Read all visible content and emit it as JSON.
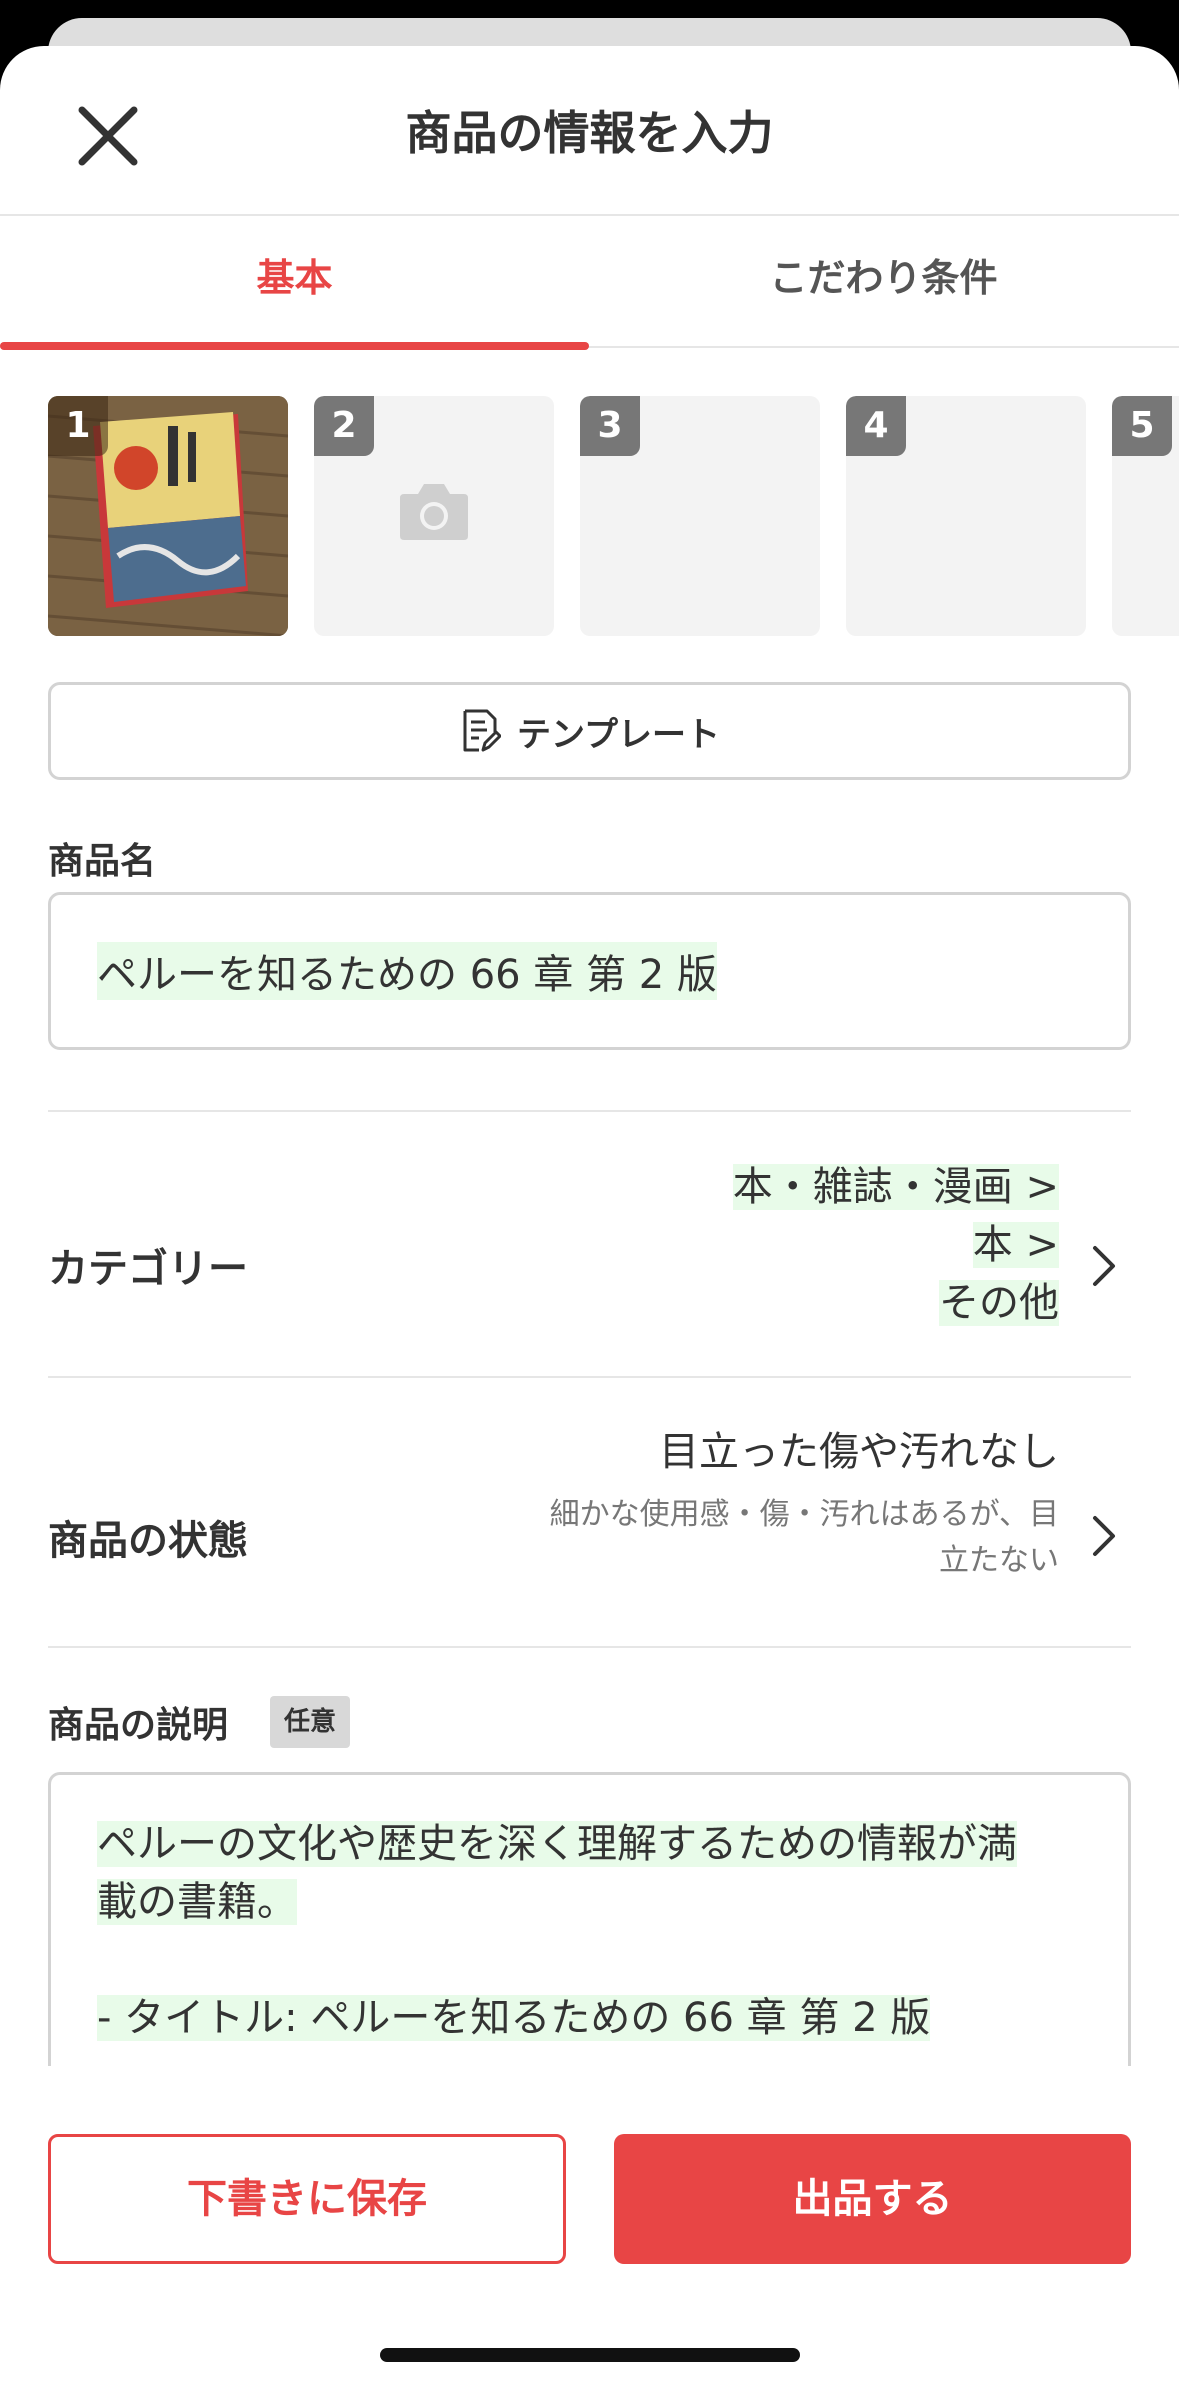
{
  "header": {
    "title": "商品の情報を入力"
  },
  "tabs": [
    {
      "label": "基本",
      "active": true
    },
    {
      "label": "こだわり条件",
      "active": false
    }
  ],
  "photos": [
    {
      "num": "1",
      "filled": true
    },
    {
      "num": "2",
      "filled": false,
      "icon": "camera-icon"
    },
    {
      "num": "3",
      "filled": false
    },
    {
      "num": "4",
      "filled": false
    },
    {
      "num": "5",
      "filled": false
    }
  ],
  "template": {
    "label": "テンプレート"
  },
  "product_name": {
    "label": "商品名",
    "value": "ペルーを知るための 66 章 第 2 版"
  },
  "category": {
    "label": "カテゴリー",
    "lines": [
      "本・雑誌・漫画 >",
      "本 >",
      "その他"
    ]
  },
  "condition": {
    "label": "商品の状態",
    "value": "目立った傷や汚れなし",
    "sub_line1": "細かな使用感・傷・汚れはあるが、目",
    "sub_line2": "立たない"
  },
  "description": {
    "label": "商品の説明",
    "badge": "任意",
    "line1": "ペルーの文化や歴史を深く理解するための情報が満",
    "line2": "載の書籍。",
    "line3": "- タイトル: ペルーを知るための 66 章 第 2 版"
  },
  "actions": {
    "draft_label": "下書きに保存",
    "list_label": "出品する"
  },
  "colors": {
    "accent": "#e84545",
    "highlight": "#e8fbe9"
  }
}
